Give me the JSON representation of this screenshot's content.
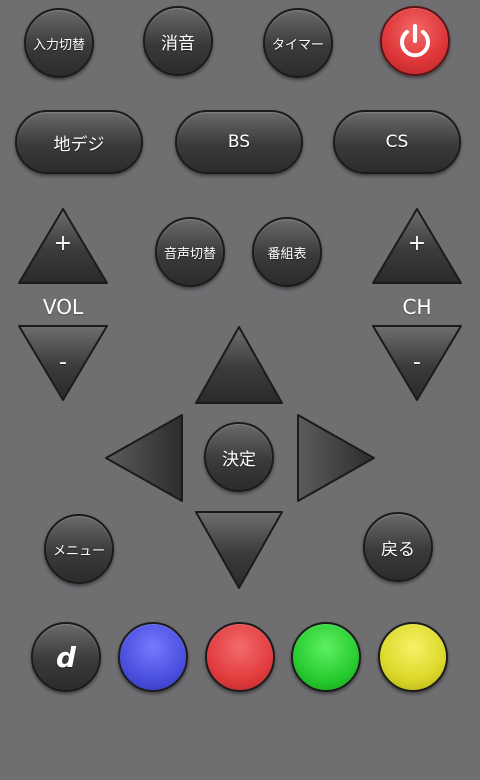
{
  "top_row": {
    "input_switch": "入力切替",
    "mute": "消音",
    "timer": "タイマー",
    "power_color": "#e53a3c"
  },
  "broadcast": {
    "terrestrial": "地デジ",
    "bs": "BS",
    "cs": "CS"
  },
  "volume": {
    "up": "+",
    "label": "VOL",
    "down": "-"
  },
  "channel": {
    "up": "+",
    "label": "CH",
    "down": "-"
  },
  "middle": {
    "audio_switch": "音声切替",
    "program_guide": "番組表"
  },
  "dpad": {
    "ok": "決定"
  },
  "menu": "メニュー",
  "back": "戻る",
  "color_keys": {
    "d_label": "d",
    "blue": "#4b4fdf",
    "red": "#e23d3f",
    "green": "#27cc2f",
    "yellow": "#dcd82a"
  },
  "icons": {
    "power": "power-icon",
    "up": "triangle-up-icon",
    "down": "triangle-down-icon",
    "left": "triangle-left-icon",
    "right": "triangle-right-icon"
  }
}
